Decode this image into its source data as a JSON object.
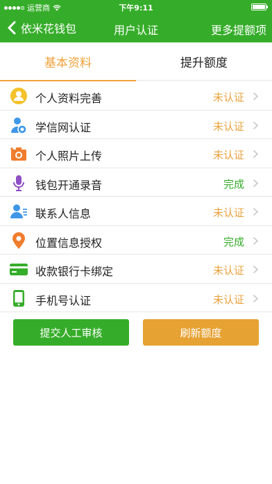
{
  "status_bar": {
    "carrier": "运营商",
    "time": "下午9:11"
  },
  "navbar": {
    "back_label": "依米花钱包",
    "title": "用户认证",
    "right_label": "更多提额项"
  },
  "tabs": [
    {
      "label": "基本资料",
      "active": true
    },
    {
      "label": "提升额度",
      "active": false
    }
  ],
  "items": [
    {
      "label": "个人资料完善",
      "status": "未认证",
      "state": "pending",
      "icon": "user-profile-icon"
    },
    {
      "label": "学信网认证",
      "status": "未认证",
      "state": "pending",
      "icon": "student-user-icon"
    },
    {
      "label": "个人照片上传",
      "status": "未认证",
      "state": "pending",
      "icon": "camera-icon"
    },
    {
      "label": "钱包开通录音",
      "status": "完成",
      "state": "done",
      "icon": "microphone-icon"
    },
    {
      "label": "联系人信息",
      "status": "未认证",
      "state": "pending",
      "icon": "contacts-icon"
    },
    {
      "label": "位置信息授权",
      "status": "完成",
      "state": "done",
      "icon": "location-pin-icon"
    },
    {
      "label": "收款银行卡绑定",
      "status": "未认证",
      "state": "pending",
      "icon": "bank-card-icon"
    },
    {
      "label": "手机号认证",
      "status": "未认证",
      "state": "pending",
      "icon": "phone-icon"
    }
  ],
  "buttons": {
    "submit": "提交人工审核",
    "refresh": "刷新额度"
  },
  "colors": {
    "brand_green": "#36ad2a",
    "accent_orange": "#f0a23b"
  }
}
